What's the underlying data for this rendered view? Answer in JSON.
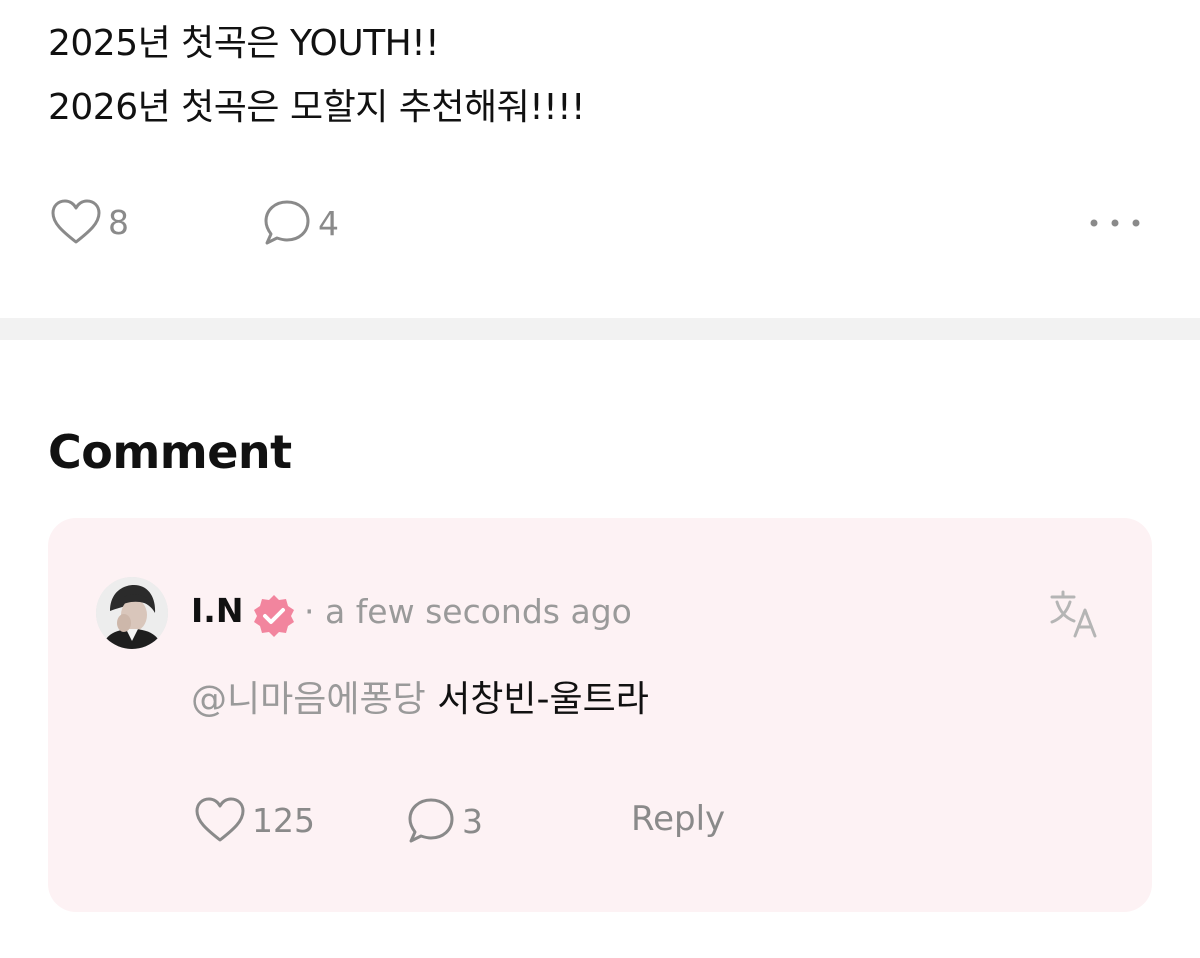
{
  "post": {
    "lines": [
      "2025년 첫곡은 YOUTH!!",
      "2026년 첫곡은 모할지 추천해줘!!!!"
    ],
    "like_count": "8",
    "comment_count": "4",
    "icons": {
      "like": "heart-icon",
      "comment": "speech-bubble-icon",
      "more": "more-dots-icon"
    }
  },
  "comments_section": {
    "title": "Comment",
    "comment": {
      "author": "I.N",
      "badge": "verified-badge-icon",
      "badge_color": "#f2859e",
      "time": "· a few seconds ago",
      "mention": "@니마음에퐁당",
      "text": "서창빈-울트라",
      "like_count": "125",
      "reply_count": "3",
      "reply_label": "Reply",
      "icons": {
        "translate": "translate-icon",
        "like": "heart-icon",
        "comment": "speech-bubble-icon"
      }
    }
  },
  "colors": {
    "text_primary": "#111111",
    "text_secondary": "#8a8a8a",
    "card_background": "#fdf2f4",
    "divider": "#f2f2f2"
  }
}
